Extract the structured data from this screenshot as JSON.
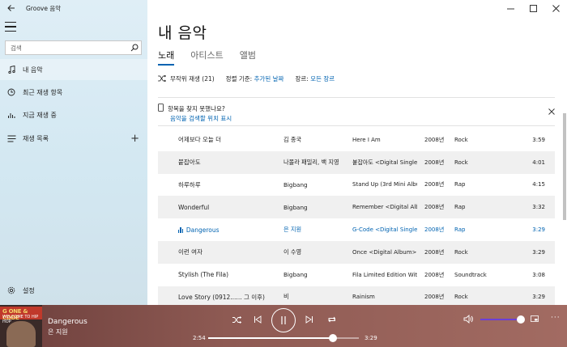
{
  "window": {
    "title": "Groove 음악"
  },
  "sidebar": {
    "search": {
      "placeholder": "검색",
      "value": ""
    },
    "items": [
      {
        "label": "내 음악",
        "icon": "music-note-icon"
      },
      {
        "label": "최근 재생 항목",
        "icon": "clock-icon"
      },
      {
        "label": "지금 재생 중",
        "icon": "bars-icon"
      },
      {
        "label": "재생 목록",
        "icon": "playlist-icon",
        "add": "+"
      }
    ],
    "settings_label": "설정"
  },
  "main": {
    "title": "내 음악",
    "tabs": [
      {
        "label": "노래",
        "active": true
      },
      {
        "label": "아티스트",
        "active": false
      },
      {
        "label": "앨범",
        "active": false
      }
    ],
    "toolbar": {
      "shuffle_label": "무작위 재생 (21)",
      "sort_prefix": "정렬 기준:",
      "sort_value": "추가된 날짜",
      "genre_prefix": "장르:",
      "genre_value": "모든 장르"
    },
    "notice": {
      "text": "항목을 찾지 못했나요?",
      "link": "음악을 검색할 위치 표시"
    },
    "songs": [
      {
        "title": "어제보다 오늘 더",
        "artist": "김 종국",
        "album": "Here I Am",
        "year": "2008년",
        "genre": "Rock",
        "duration": "3:59"
      },
      {
        "title": "붙잡아도",
        "artist": "나몰라 패밀리, 백 지영",
        "album": "붙잡아도 <Digital Single",
        "year": "2008년",
        "genre": "Rock",
        "duration": "4:01"
      },
      {
        "title": "하루하루",
        "artist": "Bigbang",
        "album": "Stand Up (3rd Mini Album",
        "year": "2008년",
        "genre": "Rap",
        "duration": "4:15"
      },
      {
        "title": "Wonderful",
        "artist": "Bigbang",
        "album": "Remember <Digital Album",
        "year": "2008년",
        "genre": "Rap",
        "duration": "3:32"
      },
      {
        "title": "Dangerous",
        "artist": "은 지원",
        "album": "G-Code <Digital Single",
        "year": "2008년",
        "genre": "Rap",
        "duration": "3:29",
        "playing": true
      },
      {
        "title": "이런 여자",
        "artist": "이 수영",
        "album": "Once <Digital Album>",
        "year": "2008년",
        "genre": "Rock",
        "duration": "3:29"
      },
      {
        "title": "Stylish (The Fila)",
        "artist": "Bigbang",
        "album": "Fila Limited Edition Witl",
        "year": "2008년",
        "genre": "Soundtrack",
        "duration": "3:08"
      },
      {
        "title": "Love Story (0912...... 그 이후)",
        "artist": "비",
        "album": "Rainism",
        "year": "2008년",
        "genre": "Rock",
        "duration": "3:29"
      }
    ]
  },
  "player": {
    "album_art_text": "G ONE & CODE",
    "album_art_subtext": "WELCOME TO HIP HOP",
    "title": "Dangerous",
    "artist": "은 지원",
    "time_current": "2:54",
    "time_total": "3:29",
    "progress_fraction": 0.83,
    "volume_fraction": 1.0
  },
  "colors": {
    "accent": "#0063b1",
    "player_bg": "#8e5a53"
  }
}
